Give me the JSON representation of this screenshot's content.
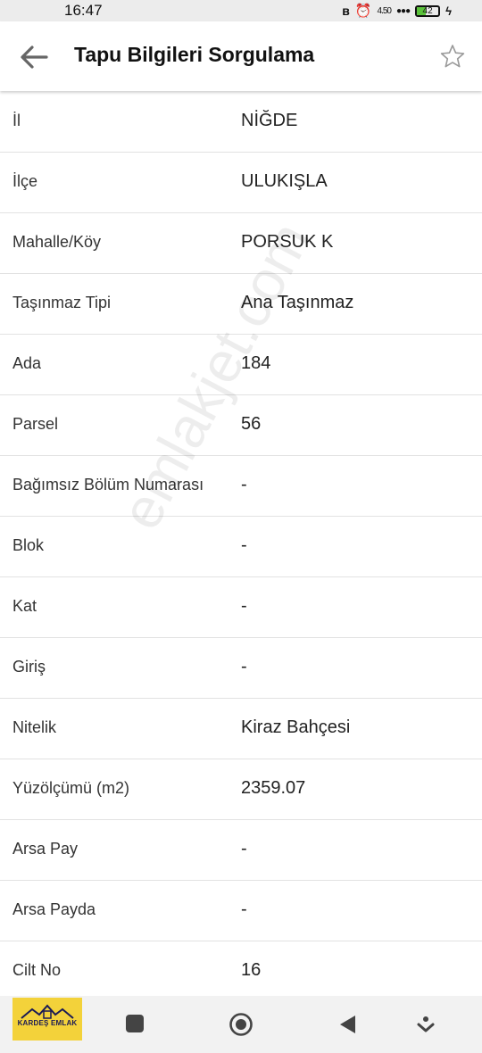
{
  "status_bar": {
    "time": "16:47",
    "net_speed": "4.50",
    "battery": "42",
    "battery_level": 0.42,
    "icons": [
      "bluetooth-icon",
      "alarm-icon",
      "network-icon",
      "battery-icon",
      "charging-icon"
    ]
  },
  "header": {
    "title": "Tapu Bilgileri Sorgulama",
    "back_icon": "arrow-left-icon",
    "star_icon": "star-outline-icon"
  },
  "rows": [
    {
      "label": "İl",
      "value": "NİĞDE"
    },
    {
      "label": "İlçe",
      "value": "ULUKIŞLA"
    },
    {
      "label": "Mahalle/Köy",
      "value": "PORSUK K"
    },
    {
      "label": "Taşınmaz Tipi",
      "value": "Ana Taşınmaz"
    },
    {
      "label": "Ada",
      "value": "184"
    },
    {
      "label": "Parsel",
      "value": "56"
    },
    {
      "label": "Bağımsız Bölüm Numarası",
      "value": "-"
    },
    {
      "label": "Blok",
      "value": "-"
    },
    {
      "label": "Kat",
      "value": "-"
    },
    {
      "label": "Giriş",
      "value": "-"
    },
    {
      "label": "Nitelik",
      "value": "Kiraz Bahçesi"
    },
    {
      "label": "Yüzölçümü (m2)",
      "value": "2359.07"
    },
    {
      "label": "Arsa Pay",
      "value": "-"
    },
    {
      "label": "Arsa Payda",
      "value": "-"
    },
    {
      "label": "Cilt No",
      "value": "16"
    }
  ],
  "watermark": "emlakjet.com",
  "nav_bar": {
    "logo_text": "KARDEŞ EMLAK",
    "icons": [
      "recents-square-icon",
      "home-circle-icon",
      "back-triangle-icon",
      "assistant-icon"
    ]
  },
  "colors": {
    "background": "#ffffff",
    "status_bar": "#ececec",
    "divider": "#e2e2e2",
    "battery": "#5bc23b",
    "logo_bg": "#f3d23a"
  }
}
